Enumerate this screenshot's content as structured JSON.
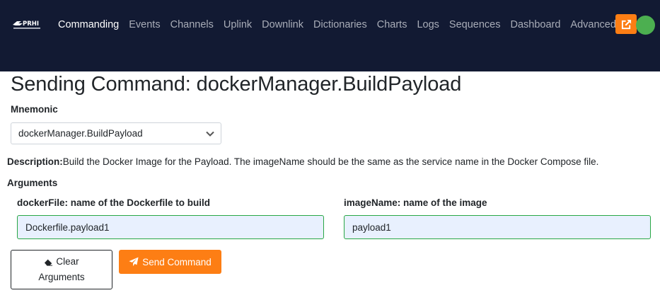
{
  "nav": {
    "items": [
      {
        "label": "Commanding",
        "active": true
      },
      {
        "label": "Events"
      },
      {
        "label": "Channels"
      },
      {
        "label": "Uplink"
      },
      {
        "label": "Downlink"
      },
      {
        "label": "Dictionaries"
      },
      {
        "label": "Charts"
      },
      {
        "label": "Logs"
      },
      {
        "label": "Sequences"
      },
      {
        "label": "Dashboard"
      },
      {
        "label": "Advanced"
      }
    ],
    "external_link_icon": "external-link-icon",
    "status_color": "#4caf50",
    "accent_color": "#fd7e14"
  },
  "page": {
    "title": "Sending Command: dockerManager.BuildPayload",
    "mnemonic_label": "Mnemonic",
    "mnemonic_value": "dockerManager.BuildPayload",
    "description_label": "Description:",
    "description_text": "Build the Docker Image for the Payload. The imageName should be the same as the service name in the Docker Compose file.",
    "arguments_label": "Arguments",
    "arguments": [
      {
        "label": "dockerFile: name of the Dockerfile to build",
        "value": "Dockerfile.payload1"
      },
      {
        "label": "imageName: name of the image",
        "value": "payload1"
      }
    ],
    "clear_button_line1": "Clear",
    "clear_button_line2": "Arguments",
    "send_button": "Send Command"
  }
}
